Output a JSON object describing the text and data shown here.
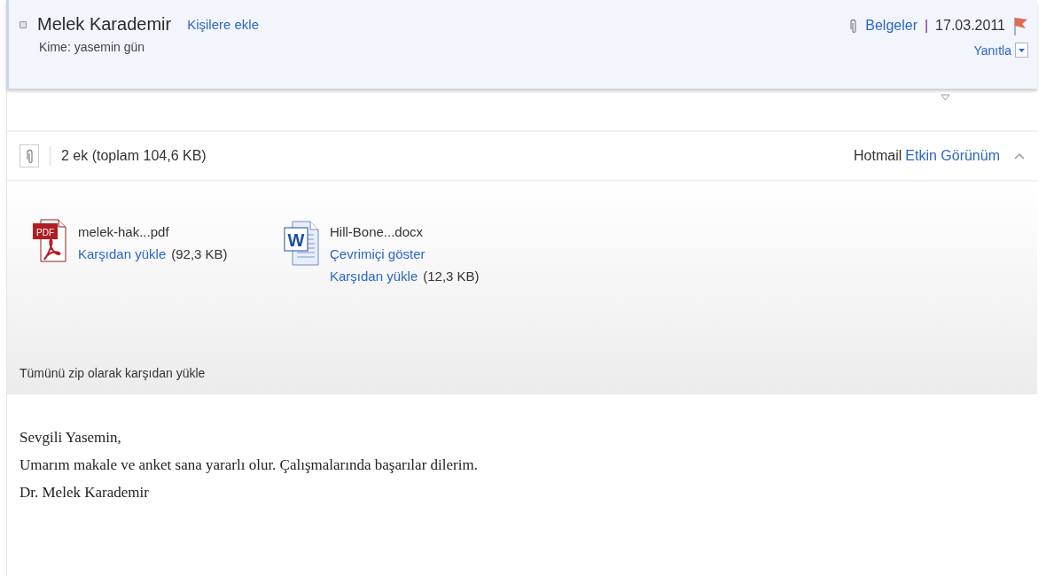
{
  "header": {
    "selected": false,
    "sender": "Melek Karademir",
    "add_contact": "Kişilere ekle",
    "to": "Kime: yasemin gün",
    "attachment_link": "Belgeler",
    "separator": "|",
    "date": "17.03.2011",
    "flagged": true,
    "reply": "Yanıtla"
  },
  "attachments": {
    "summary": "2 ek (toplam 104,6 KB)",
    "view_label": "Hotmail",
    "view_link": "Etkin Görünüm",
    "expanded": true,
    "files": [
      {
        "kind": "pdf",
        "badge": "PDF",
        "name": "melek-hak...pdf",
        "links": [
          {
            "label": "Karşıdan yükle",
            "size": "(92,3 KB)"
          }
        ]
      },
      {
        "kind": "word",
        "badge": "W",
        "name": "Hill-Bone...docx",
        "links": [
          {
            "label": "Çevrimiçi göster"
          },
          {
            "label": "Karşıdan yükle",
            "size": "(12,3 KB)"
          }
        ]
      }
    ],
    "zip_all": "Tümünü zip olarak karşıdan yükle"
  },
  "message": {
    "paragraphs": [
      "Sevgili Yasemin,",
      "Umarım makale ve anket sana yararlı olur. Çalışmalarında başarılar dilerim.",
      "Dr. Melek Karademir"
    ]
  }
}
